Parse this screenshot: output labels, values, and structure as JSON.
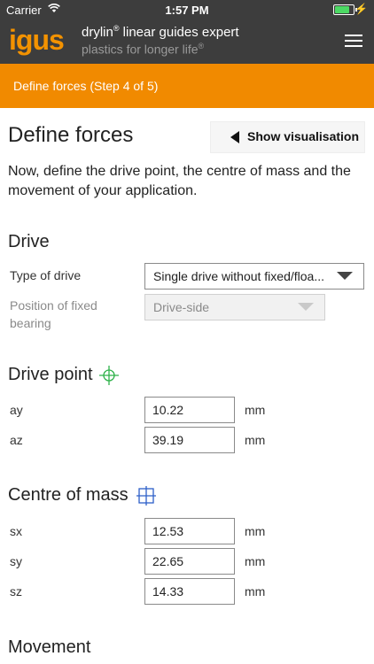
{
  "status": {
    "carrier": "Carrier",
    "time": "1:57 PM"
  },
  "app": {
    "logo": "igus",
    "title": "drylin",
    "title_sup": "®",
    "title_rest": " linear guides expert",
    "subtitle": "plastics for longer life",
    "subtitle_sup": "®"
  },
  "step": {
    "label": "Define forces (Step 4 of 5)"
  },
  "page": {
    "title": "Define forces",
    "visual_button": "Show visualisation",
    "intro": "Now, define the drive point, the centre of mass and the movement of your application."
  },
  "drive": {
    "heading": "Drive",
    "type_label": "Type of drive",
    "type_value": "Single drive without fixed/floa...",
    "bearing_label": "Position of fixed bearing",
    "bearing_value": "Drive-side"
  },
  "drive_point": {
    "heading": "Drive point",
    "fields": [
      {
        "label": "ay",
        "value": "10.22",
        "unit": "mm"
      },
      {
        "label": "az",
        "value": "39.19",
        "unit": "mm"
      }
    ]
  },
  "centre_of_mass": {
    "heading": "Centre of mass",
    "fields": [
      {
        "label": "sx",
        "value": "12.53",
        "unit": "mm"
      },
      {
        "label": "sy",
        "value": "22.65",
        "unit": "mm"
      },
      {
        "label": "sz",
        "value": "14.33",
        "unit": "mm"
      }
    ]
  },
  "movement": {
    "heading": "Movement"
  },
  "colors": {
    "brand_orange": "#f18a00",
    "header_dark": "#3d3d3d",
    "target_green": "#2fb24a",
    "grid_blue": "#2d5fc8"
  },
  "battery_level": 0.9
}
